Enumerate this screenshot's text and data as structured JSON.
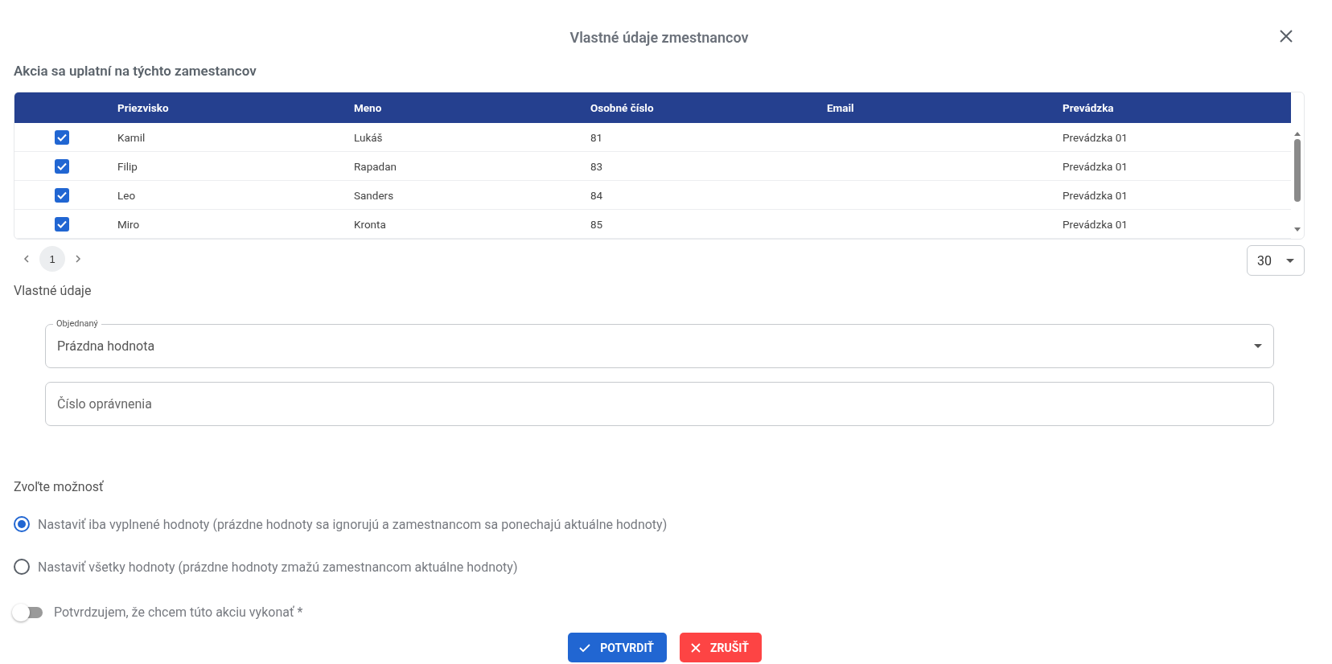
{
  "dialog": {
    "title": "Vlastné údaje zmestnancov"
  },
  "employees": {
    "heading": "Akcia sa uplatní na týchto zamestancov",
    "columns": [
      "Priezvisko",
      "Meno",
      "Osobné číslo",
      "Email",
      "Prevádzka"
    ],
    "rows": [
      {
        "checked": true,
        "cells": [
          "Kamil",
          "Lukáš",
          "81",
          "",
          "Prevádzka 01"
        ]
      },
      {
        "checked": true,
        "cells": [
          "Filip",
          "Rapadan",
          "83",
          "",
          "Prevádzka 01"
        ]
      },
      {
        "checked": true,
        "cells": [
          "Leo",
          "Sanders",
          "84",
          "",
          "Prevádzka 01"
        ]
      },
      {
        "checked": true,
        "cells": [
          "Miro",
          "Kronta",
          "85",
          "",
          "Prevádzka 01"
        ]
      }
    ]
  },
  "pagination": {
    "pages": [
      {
        "label": "1",
        "selected": true
      }
    ],
    "page_size": "30"
  },
  "custom": {
    "heading": "Vlastné údaje",
    "fields": [
      {
        "kind": "select",
        "label": "Objednaný",
        "value": "Prázdna hodnota"
      },
      {
        "kind": "text",
        "placeholder": "Číslo oprávnenia"
      }
    ]
  },
  "option": {
    "heading": "Zvoľte možnosť",
    "radios": [
      {
        "label": "Nastaviť iba vyplnené hodnoty (prázdne hodnoty sa ignorujú a zamestnancom sa ponechajú aktuálne hodnoty)",
        "selected": true
      },
      {
        "label": "Nastaviť všetky hodnoty (prázdne hodnoty zmažú zamestnancom aktuálne hodnoty)",
        "selected": false
      }
    ]
  },
  "confirm": {
    "label": "Potvrdzujem, že chcem túto akciu vykonať *",
    "on": false
  },
  "buttons": [
    {
      "kind": "confirm",
      "label": "POTVRDIŤ"
    },
    {
      "kind": "cancel",
      "label": "ZRUŠIŤ"
    }
  ]
}
